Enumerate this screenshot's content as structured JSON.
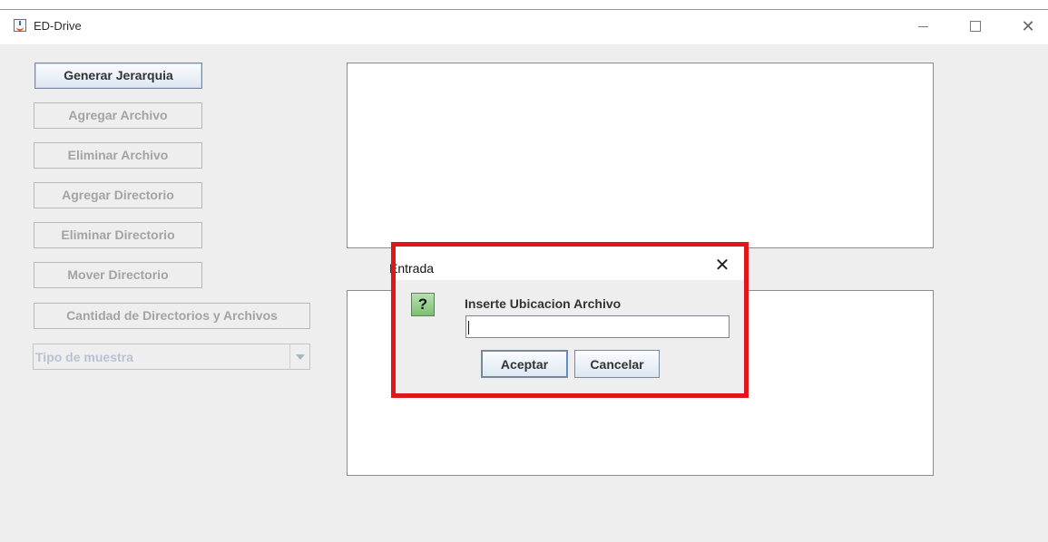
{
  "window": {
    "title": "ED-Drive",
    "controls": {
      "minimize": "—",
      "maximize": "☐",
      "close": "✕"
    }
  },
  "sidebar": {
    "buttons": [
      {
        "label": "Generar Jerarquia",
        "enabled": true
      },
      {
        "label": "Agregar Archivo",
        "enabled": false
      },
      {
        "label": "Eliminar Archivo",
        "enabled": false
      },
      {
        "label": "Agregar Directorio",
        "enabled": false
      },
      {
        "label": "Eliminar Directorio",
        "enabled": false
      },
      {
        "label": "Mover Directorio",
        "enabled": false
      },
      {
        "label": "Cantidad de Directorios y Archivos",
        "enabled": false
      }
    ],
    "combo": {
      "placeholder": "Tipo de muestra",
      "enabled": false
    }
  },
  "dialog": {
    "title": "Entrada",
    "close": "✕",
    "icon": "question-icon",
    "icon_glyph": "?",
    "message": "Inserte Ubicacion Archivo",
    "input_value": "",
    "ok_label": "Aceptar",
    "cancel_label": "Cancelar"
  },
  "colors": {
    "highlight": "#e0161b",
    "disabled_text": "#a3a3a3",
    "icon_green": "#7cc071"
  }
}
